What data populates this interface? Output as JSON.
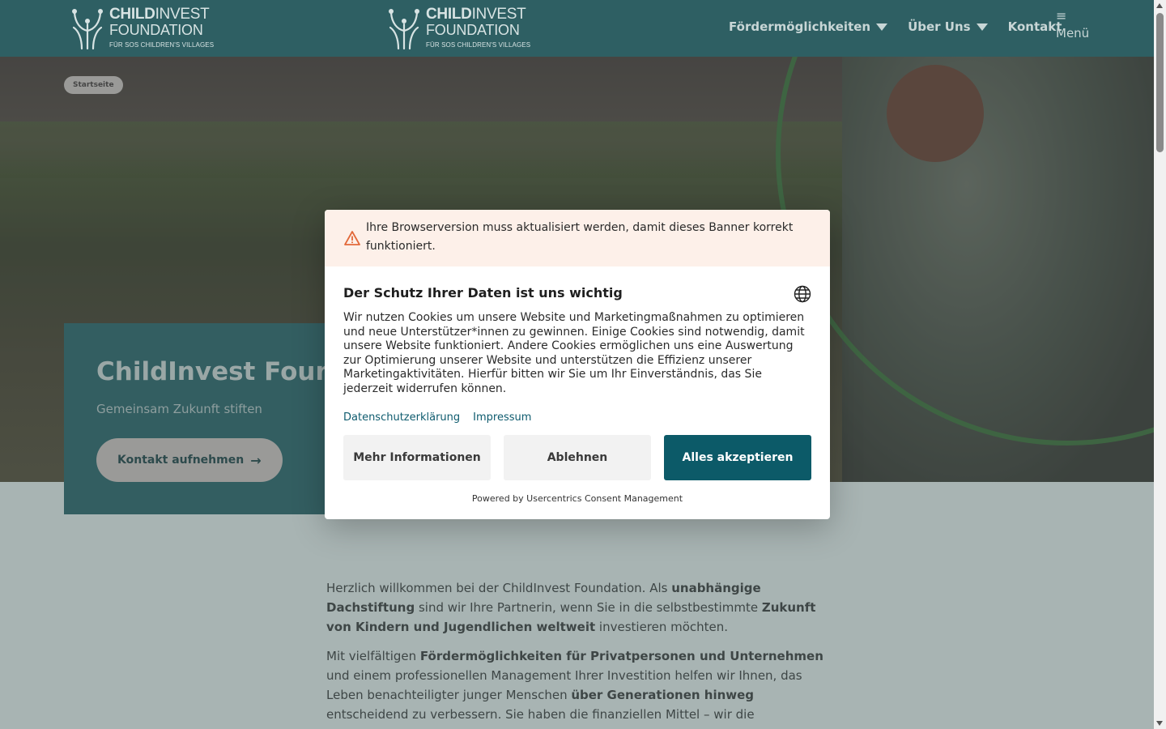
{
  "header": {
    "logo_left": {
      "line1_bold": "CHILD",
      "line1_rest": "INVEST",
      "line2": "FOUNDATION",
      "line3": "FÜR SOS CHILDREN'S VILLAGES"
    },
    "logo_center": {
      "line1_bold": "CHILD",
      "line1_rest": "INVEST",
      "line2": "FOUNDATION",
      "line3": "FÜR SOS CHILDREN'S VILLAGES"
    },
    "nav": {
      "foerder": "Fördermöglichkeiten",
      "ueber": "Über Uns",
      "kontakt": "Kontakt"
    },
    "menu_label": "Menü",
    "menu_icon": "hamburger-icon"
  },
  "hero": {
    "breadcrumb": "Startseite",
    "title": "ChildInvest Foundation",
    "subtitle": "Gemeinsam Zukunft stiften",
    "cta_label": "Kontakt aufnehmen",
    "cta_icon": "arrow-right-icon"
  },
  "content": {
    "p1": {
      "t1": "Herzlich willkommen bei der ChildInvest Foundation. Als ",
      "b1": "unabhängige Dachstiftung",
      "t2": " sind wir Ihre Partnerin, wenn Sie in die selbstbestimmte ",
      "b2": "Zukunft von Kindern und Jugendlichen weltweit",
      "t3": " investieren möchten."
    },
    "p2": {
      "t1": "Mit vielfältigen ",
      "b1": "Fördermöglichkeiten für Privatpersonen und Unternehmen",
      "t2": " und einem professionellen Management Ihrer Investition helfen wir Ihnen, das Leben benachteiligter junger Menschen ",
      "b2": "über Generationen hinweg",
      "t3": " entscheidend zu verbessern. Sie haben die finanziellen Mittel – wir die"
    }
  },
  "consent": {
    "warning_text": "Ihre Browserversion muss aktualisiert werden, damit dieses Banner korrekt funktioniert.",
    "warning_icon": "warning-icon",
    "title": "Der Schutz Ihrer Daten ist uns wichtig",
    "language_icon": "globe-icon",
    "body": "Wir nutzen Cookies um unsere Website und Marketingmaßnahmen zu optimieren und neue Unterstützer*innen zu gewinnen. Einige Cookies sind notwendig, damit unsere Website funktioniert. Andere Cookies ermöglichen uns eine Auswertung zur Optimierung unserer Website und unterstützen die Effizienz unserer Marketingaktivitäten. Hierfür bitten wir Sie um Ihr Einverständnis, das Sie jederzeit widerrufen können.",
    "link_privacy": "Datenschutzerklärung",
    "link_imprint": "Impressum",
    "btn_more": "Mehr Informationen",
    "btn_deny": "Ablehnen",
    "btn_accept": "Alles akzeptieren",
    "powered_by": "Powered by Usercentrics Consent Management"
  },
  "colors": {
    "header_bg": "#2e5f63",
    "accept_bg": "#0c5a68",
    "warning_bg": "#fdf0e9",
    "ring": "#3f7a45"
  }
}
